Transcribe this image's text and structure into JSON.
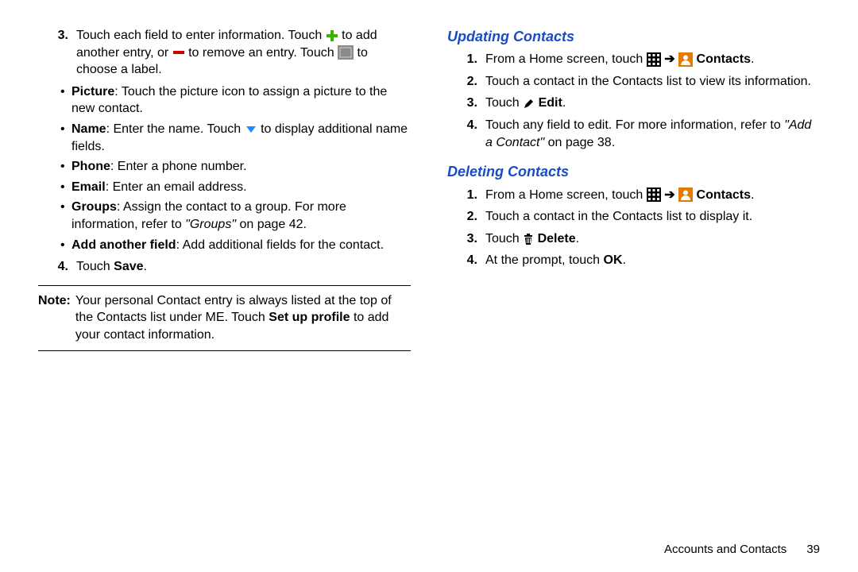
{
  "left": {
    "step3": {
      "num": "3.",
      "pre": "Touch each field to enter information. Touch ",
      "mid1": " to add another entry, or ",
      "mid2": " to remove an entry. Touch ",
      "post": " to choose a label."
    },
    "bullets": {
      "picture_label": "Picture",
      "picture_text": ": Touch the picture icon to assign a picture to the new contact.",
      "name_label": "Name",
      "name_pre": ": Enter the name. Touch ",
      "name_post": " to display additional name fields.",
      "phone_label": "Phone",
      "phone_text": ": Enter a phone number.",
      "email_label": "Email",
      "email_text": ": Enter an email address.",
      "groups_label": "Groups",
      "groups_pre": ": Assign the contact to a group. For more information, refer to ",
      "groups_ref": "\"Groups\"",
      "groups_post": " on page 42.",
      "addfield_label": "Add another field",
      "addfield_text": ": Add additional fields for the contact."
    },
    "step4": {
      "num": "4.",
      "pre": "Touch ",
      "bold": "Save",
      "post": "."
    },
    "note": {
      "label": "Note:",
      "pre": "Your personal Contact entry is always listed at the top of the Contacts list under ME. Touch ",
      "bold": "Set up profile",
      "post": " to add your contact information."
    }
  },
  "right": {
    "updating": {
      "heading": "Updating Contacts",
      "s1": {
        "num": "1.",
        "pre": "From a Home screen, touch ",
        "arrow": " ➔ ",
        "bold": "Contacts",
        "post": "."
      },
      "s2": {
        "num": "2.",
        "text": "Touch a contact in the Contacts list to view its information."
      },
      "s3": {
        "num": "3.",
        "pre": "Touch ",
        "bold": "Edit",
        "post": "."
      },
      "s4": {
        "num": "4.",
        "pre": "Touch any field to edit. For more information, refer to ",
        "ref": "\"Add a Contact\"",
        "post": " on page 38."
      }
    },
    "deleting": {
      "heading": "Deleting Contacts",
      "s1": {
        "num": "1.",
        "pre": "From a Home screen, touch ",
        "arrow": " ➔ ",
        "bold": "Contacts",
        "post": "."
      },
      "s2": {
        "num": "2.",
        "text": "Touch a contact in the Contacts list  to display it."
      },
      "s3": {
        "num": "3.",
        "pre": "Touch ",
        "bold": "Delete",
        "post": "."
      },
      "s4": {
        "num": "4.",
        "pre": "At the prompt, touch ",
        "bold": "OK",
        "post": "."
      }
    }
  },
  "footer": {
    "section": "Accounts and Contacts",
    "page": "39"
  }
}
